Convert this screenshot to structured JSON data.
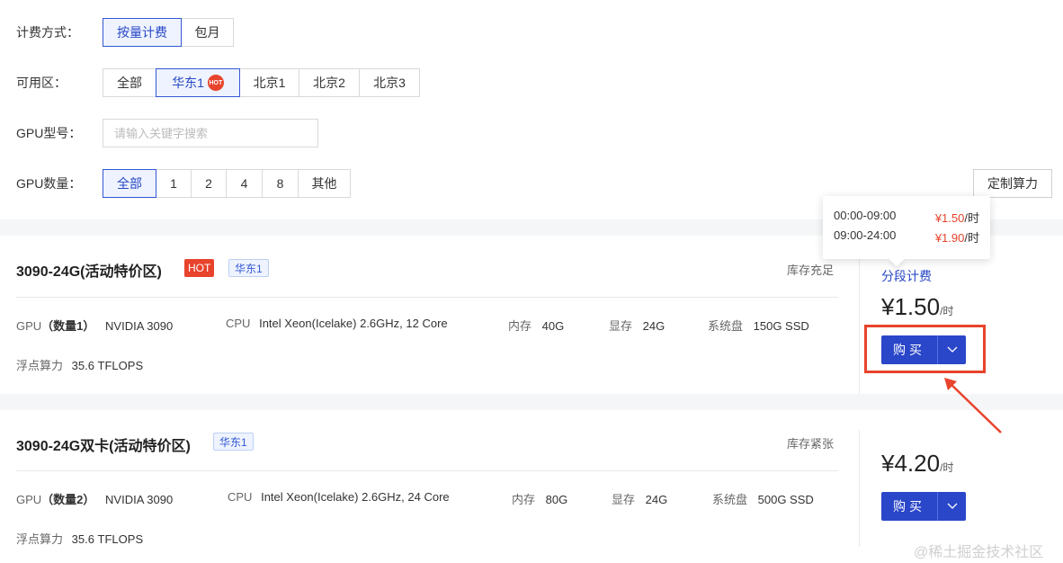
{
  "filters": {
    "billing": {
      "label": "计费方式：",
      "options": [
        "按量计费",
        "包月"
      ],
      "active": 0
    },
    "zone": {
      "label": "可用区：",
      "options": [
        "全部",
        "华东1",
        "北京1",
        "北京2",
        "北京3"
      ],
      "active": 1,
      "hot_text": "HOT"
    },
    "gpu_model": {
      "label": "GPU型号：",
      "placeholder": "请输入关键字搜索"
    },
    "gpu_count": {
      "label": "GPU数量：",
      "options": [
        "全部",
        "1",
        "2",
        "4",
        "8",
        "其他"
      ],
      "active": 0
    }
  },
  "custom_button": "定制算力",
  "tooltip": {
    "rows": [
      {
        "time": "00:00-09:00",
        "price": "¥1.50",
        "unit": "/时"
      },
      {
        "time": "09:00-24:00",
        "price": "¥1.90",
        "unit": "/时"
      }
    ]
  },
  "cards": [
    {
      "title": "3090-24G(活动特价区)",
      "hot_tag": "HOT",
      "region": "华东1",
      "stock": "库存充足",
      "gpu_key": "GPU",
      "gpu_count": "（数量1）",
      "gpu_val": "NVIDIA 3090",
      "cpu_key": "CPU",
      "cpu_val": "Intel Xeon(Icelake) 2.6GHz, 12 Core",
      "mem_key": "内存",
      "mem_val": "40G",
      "vram_key": "显存",
      "vram_val": "24G",
      "disk_key": "系统盘",
      "disk_val": "150G SSD",
      "flops_key": "浮点算力",
      "flops_val": "35.6 TFLOPS",
      "tiered_link": "分段计费",
      "price": "¥1.50",
      "price_unit": "/时",
      "buy": "购买"
    },
    {
      "title": "3090-24G双卡(活动特价区)",
      "region": "华东1",
      "stock": "库存紧张",
      "gpu_key": "GPU",
      "gpu_count": "（数量2）",
      "gpu_val": "NVIDIA 3090",
      "cpu_key": "CPU",
      "cpu_val": "Intel Xeon(Icelake) 2.6GHz, 24 Core",
      "mem_key": "内存",
      "mem_val": "80G",
      "vram_key": "显存",
      "vram_val": "24G",
      "disk_key": "系统盘",
      "disk_val": "500G SSD",
      "flops_key": "浮点算力",
      "flops_val": "35.6 TFLOPS",
      "price": "¥4.20",
      "price_unit": "/时",
      "buy": "购买"
    }
  ],
  "watermark": "@稀土掘金技术社区",
  "colors": {
    "primary": "#2a46c9",
    "hot": "#e8432c",
    "annotation": "#e8432c"
  }
}
